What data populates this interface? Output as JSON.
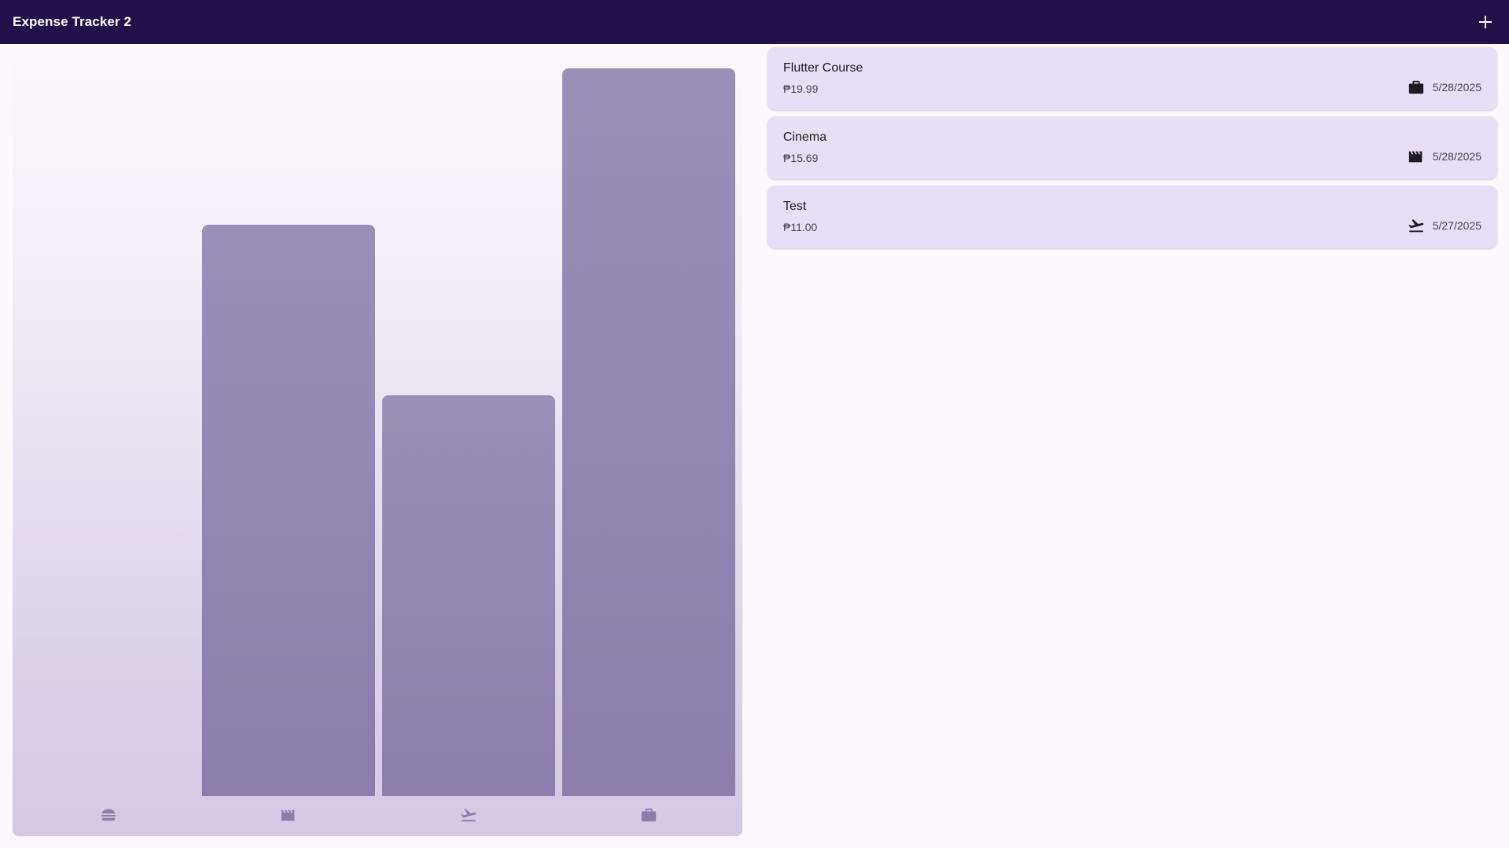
{
  "appbar": {
    "title": "Expense Tracker 2",
    "add_icon": "plus-icon"
  },
  "colors": {
    "appbar_bg": "#21104a",
    "bar": "#8f82b0",
    "card_bg": "#e8def6",
    "page_bg": "#fdf7fe"
  },
  "chart_data": {
    "type": "bar",
    "categories": [
      "food",
      "leisure",
      "travel",
      "work"
    ],
    "category_icons": [
      "burger-icon",
      "movie-icon",
      "flight-takeoff-icon",
      "briefcase-icon"
    ],
    "values": [
      0,
      15.69,
      11.0,
      19.99
    ],
    "ylim": [
      0,
      19.99
    ],
    "title": "",
    "xlabel": "",
    "ylabel": ""
  },
  "expenses": [
    {
      "title": "Flutter Course",
      "amount": "₱19.99",
      "date": "5/28/2025",
      "icon": "briefcase-icon"
    },
    {
      "title": "Cinema",
      "amount": "₱15.69",
      "date": "5/28/2025",
      "icon": "movie-icon"
    },
    {
      "title": "Test",
      "amount": "₱11.00",
      "date": "5/27/2025",
      "icon": "flight-takeoff-icon"
    }
  ]
}
